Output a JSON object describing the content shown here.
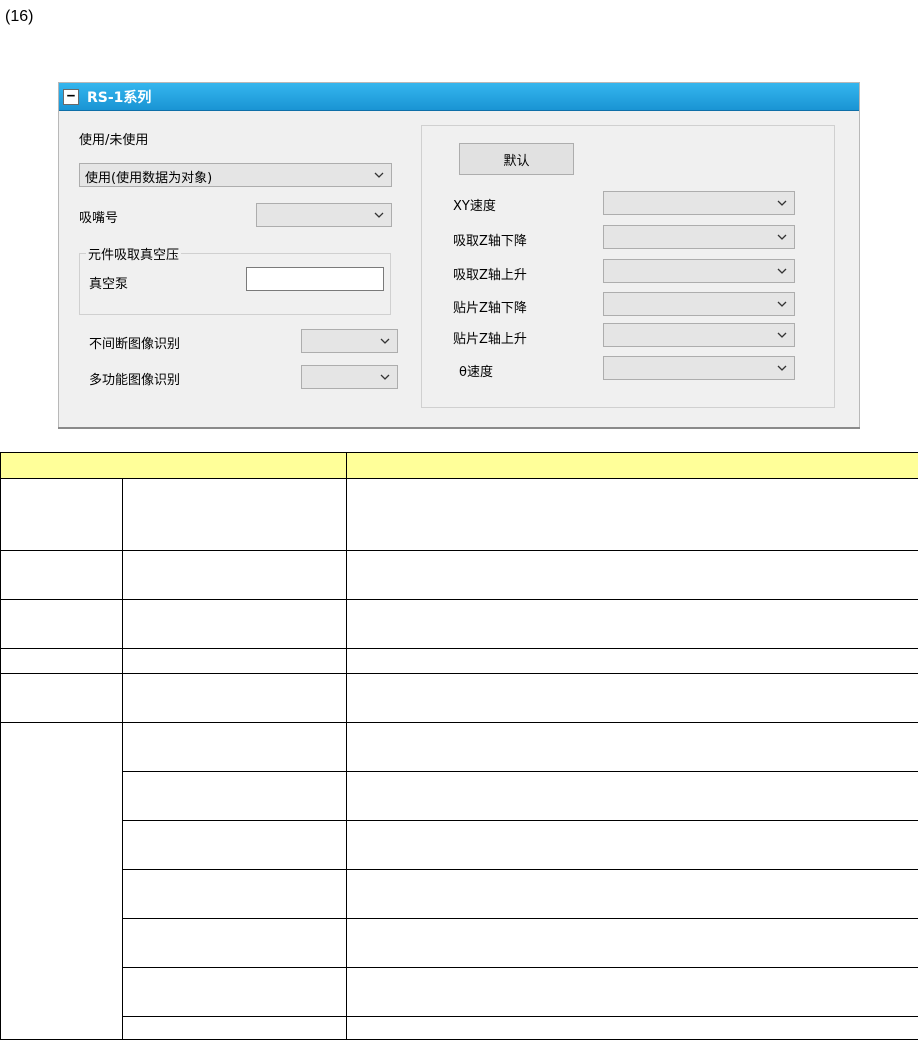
{
  "heading": "(16)",
  "panel": {
    "title": "RS-1系列",
    "collapse_symbol": "−",
    "use_label": "使用/未使用",
    "use_value": "使用(使用数据为对象)",
    "nozzle_label": "吸嘴号",
    "nozzle_value": "",
    "vacuum_group_label": "元件吸取真空压",
    "vacuum_pump_label": "真空泵",
    "vacuum_pump_value": "",
    "continuous_recog_label": "不间断图像识别",
    "continuous_recog_value": "",
    "multi_recog_label": "多功能图像识别",
    "multi_recog_value": "",
    "default_button": "默认",
    "speeds": [
      {
        "label": "XY速度",
        "value": ""
      },
      {
        "label": "吸取Z轴下降",
        "value": ""
      },
      {
        "label": "吸取Z轴上升",
        "value": ""
      },
      {
        "label": "贴片Z轴下降",
        "value": ""
      },
      {
        "label": "贴片Z轴上升",
        "value": ""
      },
      {
        "label": "θ速度",
        "value": ""
      }
    ]
  },
  "accent": {
    "title_bar": "#1a94d4",
    "table_header": "#ffff99"
  }
}
